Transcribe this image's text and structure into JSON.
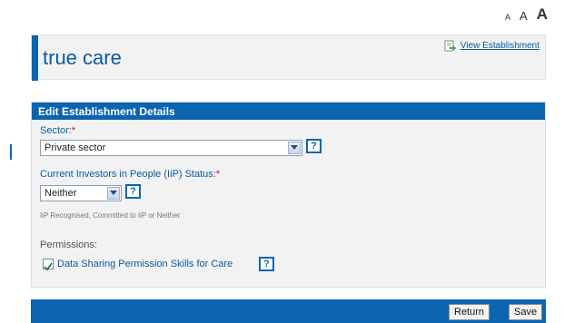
{
  "font_sizes": {
    "small": "A",
    "medium": "A",
    "large": "A"
  },
  "title_panel": {
    "title": "true care",
    "view_link": "View Establishment",
    "view_icon": "document-arrow-icon"
  },
  "form": {
    "header": "Edit Establishment Details",
    "sector": {
      "label": "Sector:",
      "required_marker": "*",
      "value": "Private sector",
      "help": "?"
    },
    "iip": {
      "label": "Current Investors in People (IiP) Status:",
      "required_marker": "*",
      "value": "Neither",
      "help": "?",
      "hint": "IiP Recognised, Committed to IiP or Neither"
    },
    "permissions": {
      "label": "Permissions:",
      "checkbox_label": "Data Sharing Permission Skills for Care",
      "checked": true,
      "help": "?"
    }
  },
  "footer": {
    "return_label": "Return",
    "save_label": "Save"
  },
  "colors": {
    "primary_blue": "#0b64b0",
    "link_blue": "#0b5aa2",
    "required_red": "#c8102e",
    "panel_bg": "#f2f2f2"
  }
}
